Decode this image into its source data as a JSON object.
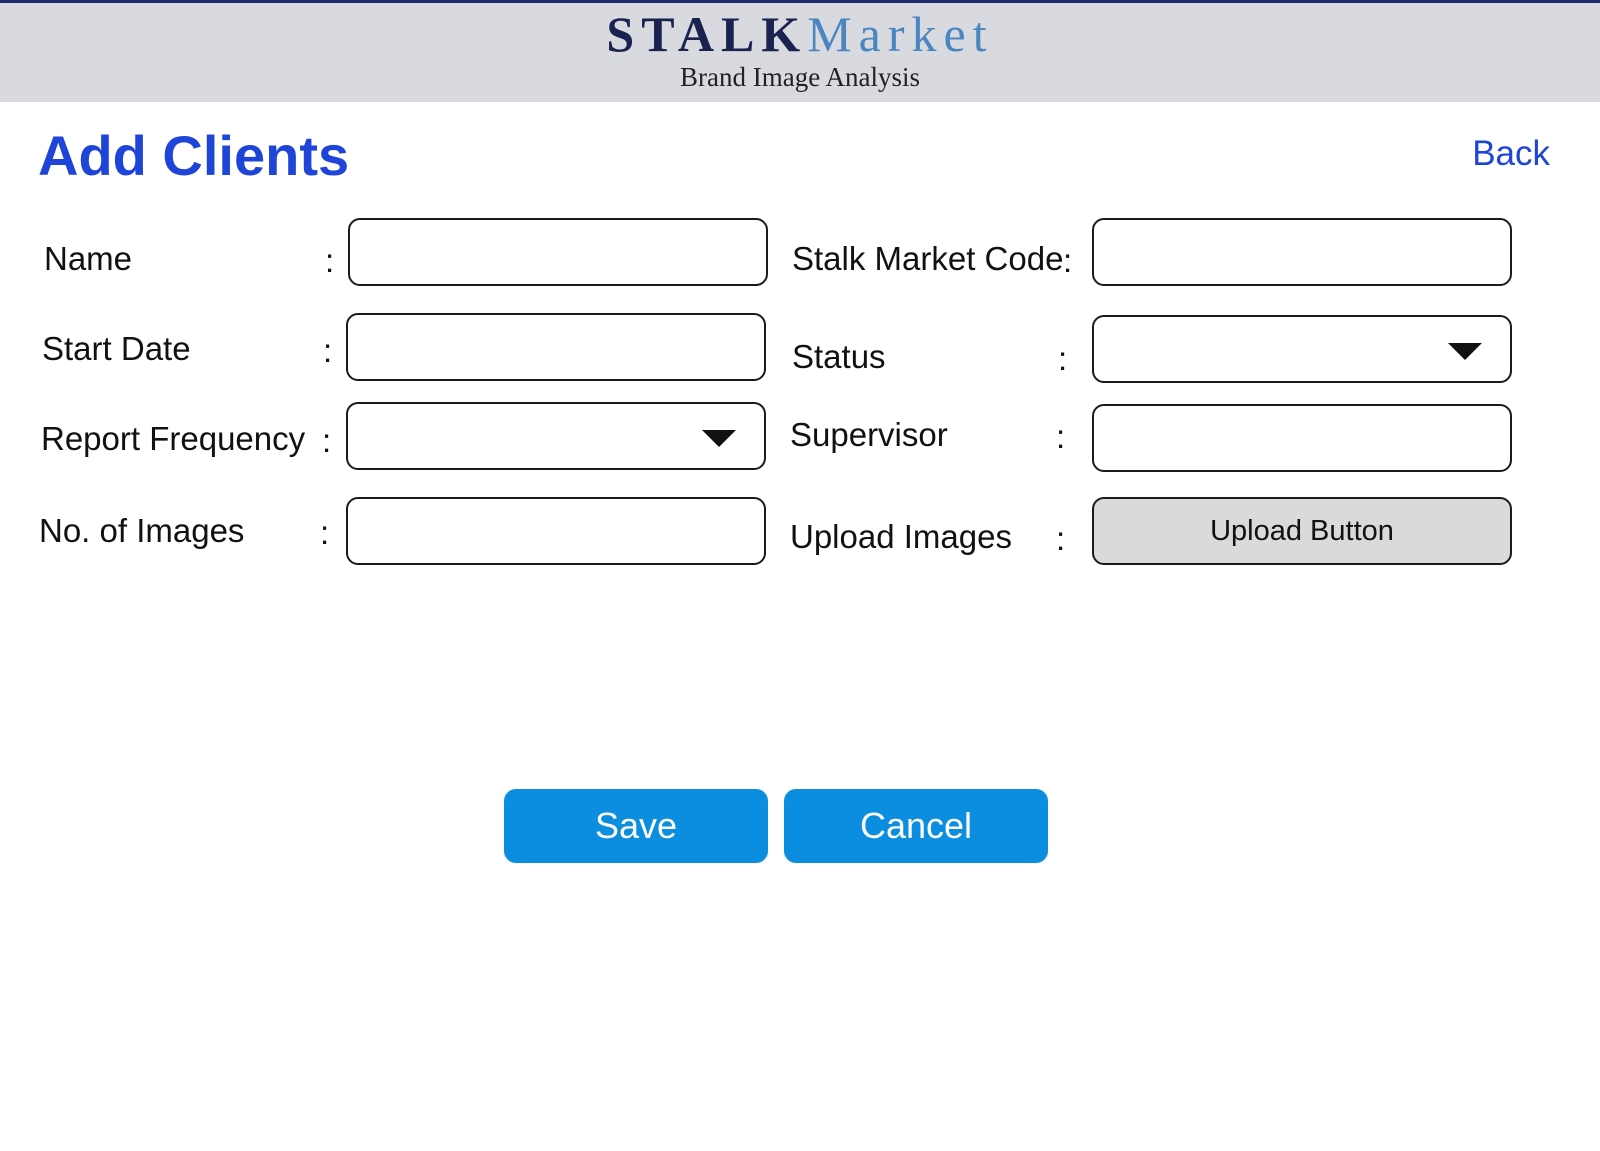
{
  "header": {
    "logo_part1": "STALK",
    "logo_part2": "Market",
    "tagline": "Brand Image Analysis"
  },
  "page": {
    "title": "Add Clients",
    "back_label": "Back"
  },
  "form": {
    "separator": ":",
    "name_label": "Name",
    "name_value": "",
    "start_date_label": "Start Date",
    "start_date_value": "",
    "report_frequency_label": "Report Frequency",
    "report_frequency_value": "",
    "no_of_images_label": "No. of Images",
    "no_of_images_value": "",
    "stalk_market_code_label": "Stalk Market Code",
    "stalk_market_code_value": "",
    "status_label": "Status",
    "status_value": "",
    "supervisor_label": "Supervisor",
    "supervisor_value": "",
    "upload_images_label": "Upload Images",
    "upload_button_label": "Upload Button"
  },
  "actions": {
    "save_label": "Save",
    "cancel_label": "Cancel"
  },
  "colors": {
    "header_bg": "#d8dadf",
    "title_blue": "#1f45d8",
    "button_blue": "#0b8de0",
    "upload_gray": "#d9dbdb"
  }
}
